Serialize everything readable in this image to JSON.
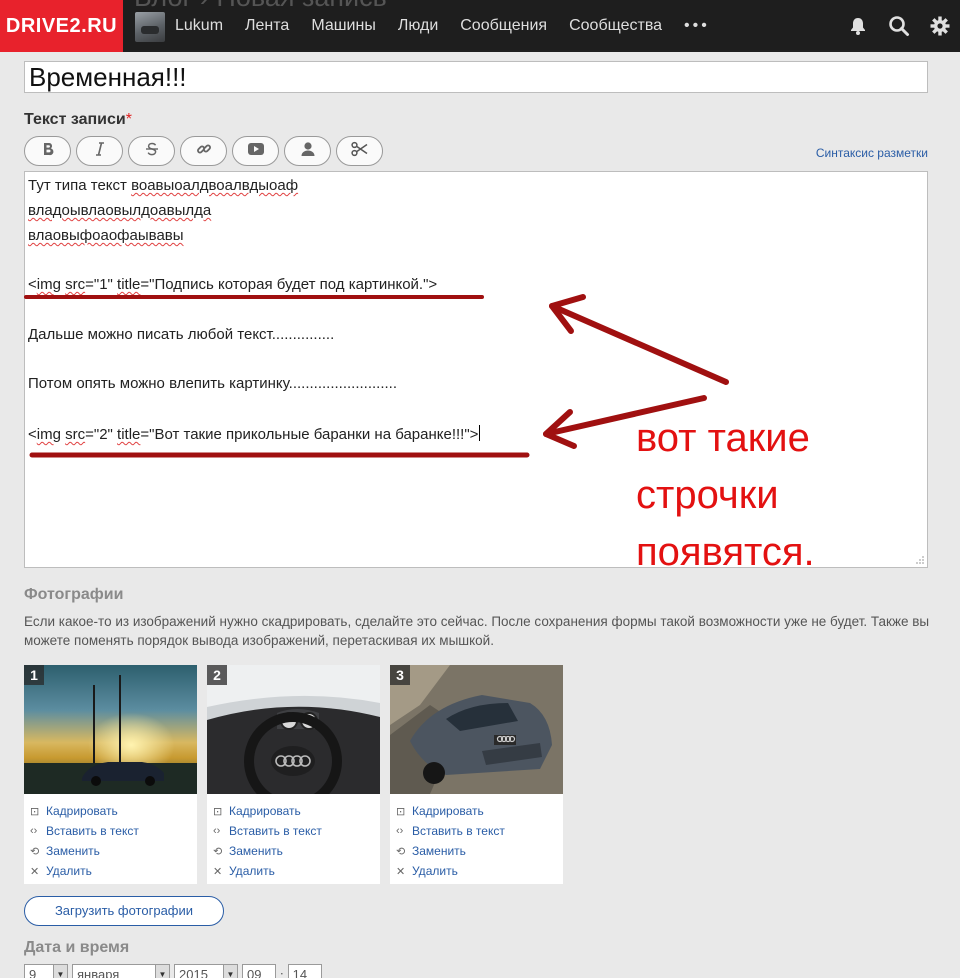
{
  "header": {
    "logo": "DRIVE2.RU",
    "behind_title": "Блог › Новая запись",
    "nav_items": [
      "Lukum",
      "Лента",
      "Машины",
      "Люди",
      "Сообщения",
      "Сообщества"
    ],
    "more": "•••",
    "icons": [
      "bell-icon",
      "search-icon",
      "gear-icon"
    ]
  },
  "form": {
    "title_value": "Временная!!!",
    "text_label": "Текст записи",
    "required_mark": "*",
    "toolbar": [
      "bold-icon",
      "italic-icon",
      "strikethrough-icon",
      "link-icon",
      "youtube-icon",
      "user-icon",
      "scissors-icon"
    ],
    "syntax_link": "Синтаксис разметки",
    "editor_lines": {
      "l1a": "Тут типа текст ",
      "l1b": "воавыоалдвоалвдыоаф",
      "l2": "владоывлаовылдоавылда",
      "l3": "влаовыфоаофаывавы",
      "l4a": "<",
      "l4b": "img",
      "l4c": " ",
      "l4d": "src",
      "l4e": "=\"1\" ",
      "l4f": "title",
      "l4g": "=\"Подпись которая будет под картинкой.\">",
      "l5": "Дальше можно писать любой текст...............",
      "l6": "Потом опять можно влепить картинку..........................",
      "l7a": "<",
      "l7b": "img",
      "l7c": " ",
      "l7d": "src",
      "l7e": "=\"2\" ",
      "l7f": "title",
      "l7g": "=\"Вот такие прикольные баранки на баранке!!!\">"
    }
  },
  "annotation": {
    "lines": [
      "вот такие",
      "строчки",
      "появятся."
    ],
    "color": "#e31111",
    "arrow_color": "#a01010"
  },
  "photos": {
    "title": "Фотографии",
    "description": "Если какое-то из изображений нужно скадрировать, сделайте это сейчас. После сохранения формы такой возможности уже не будет. Также вы можете поменять порядок вывода изображений, перетаскивая их мышкой.",
    "items": [
      {
        "num": "1"
      },
      {
        "num": "2"
      },
      {
        "num": "3"
      }
    ],
    "actions": {
      "crop": "Кадрировать",
      "insert": "Вставить в текст",
      "replace": "Заменить",
      "delete": "Удалить"
    },
    "upload_button": "Загрузить фотографии"
  },
  "datetime": {
    "title": "Дата и время",
    "day": "9",
    "month": "января",
    "year": "2015",
    "hour": "09",
    "colon": ":",
    "minute": "14"
  }
}
